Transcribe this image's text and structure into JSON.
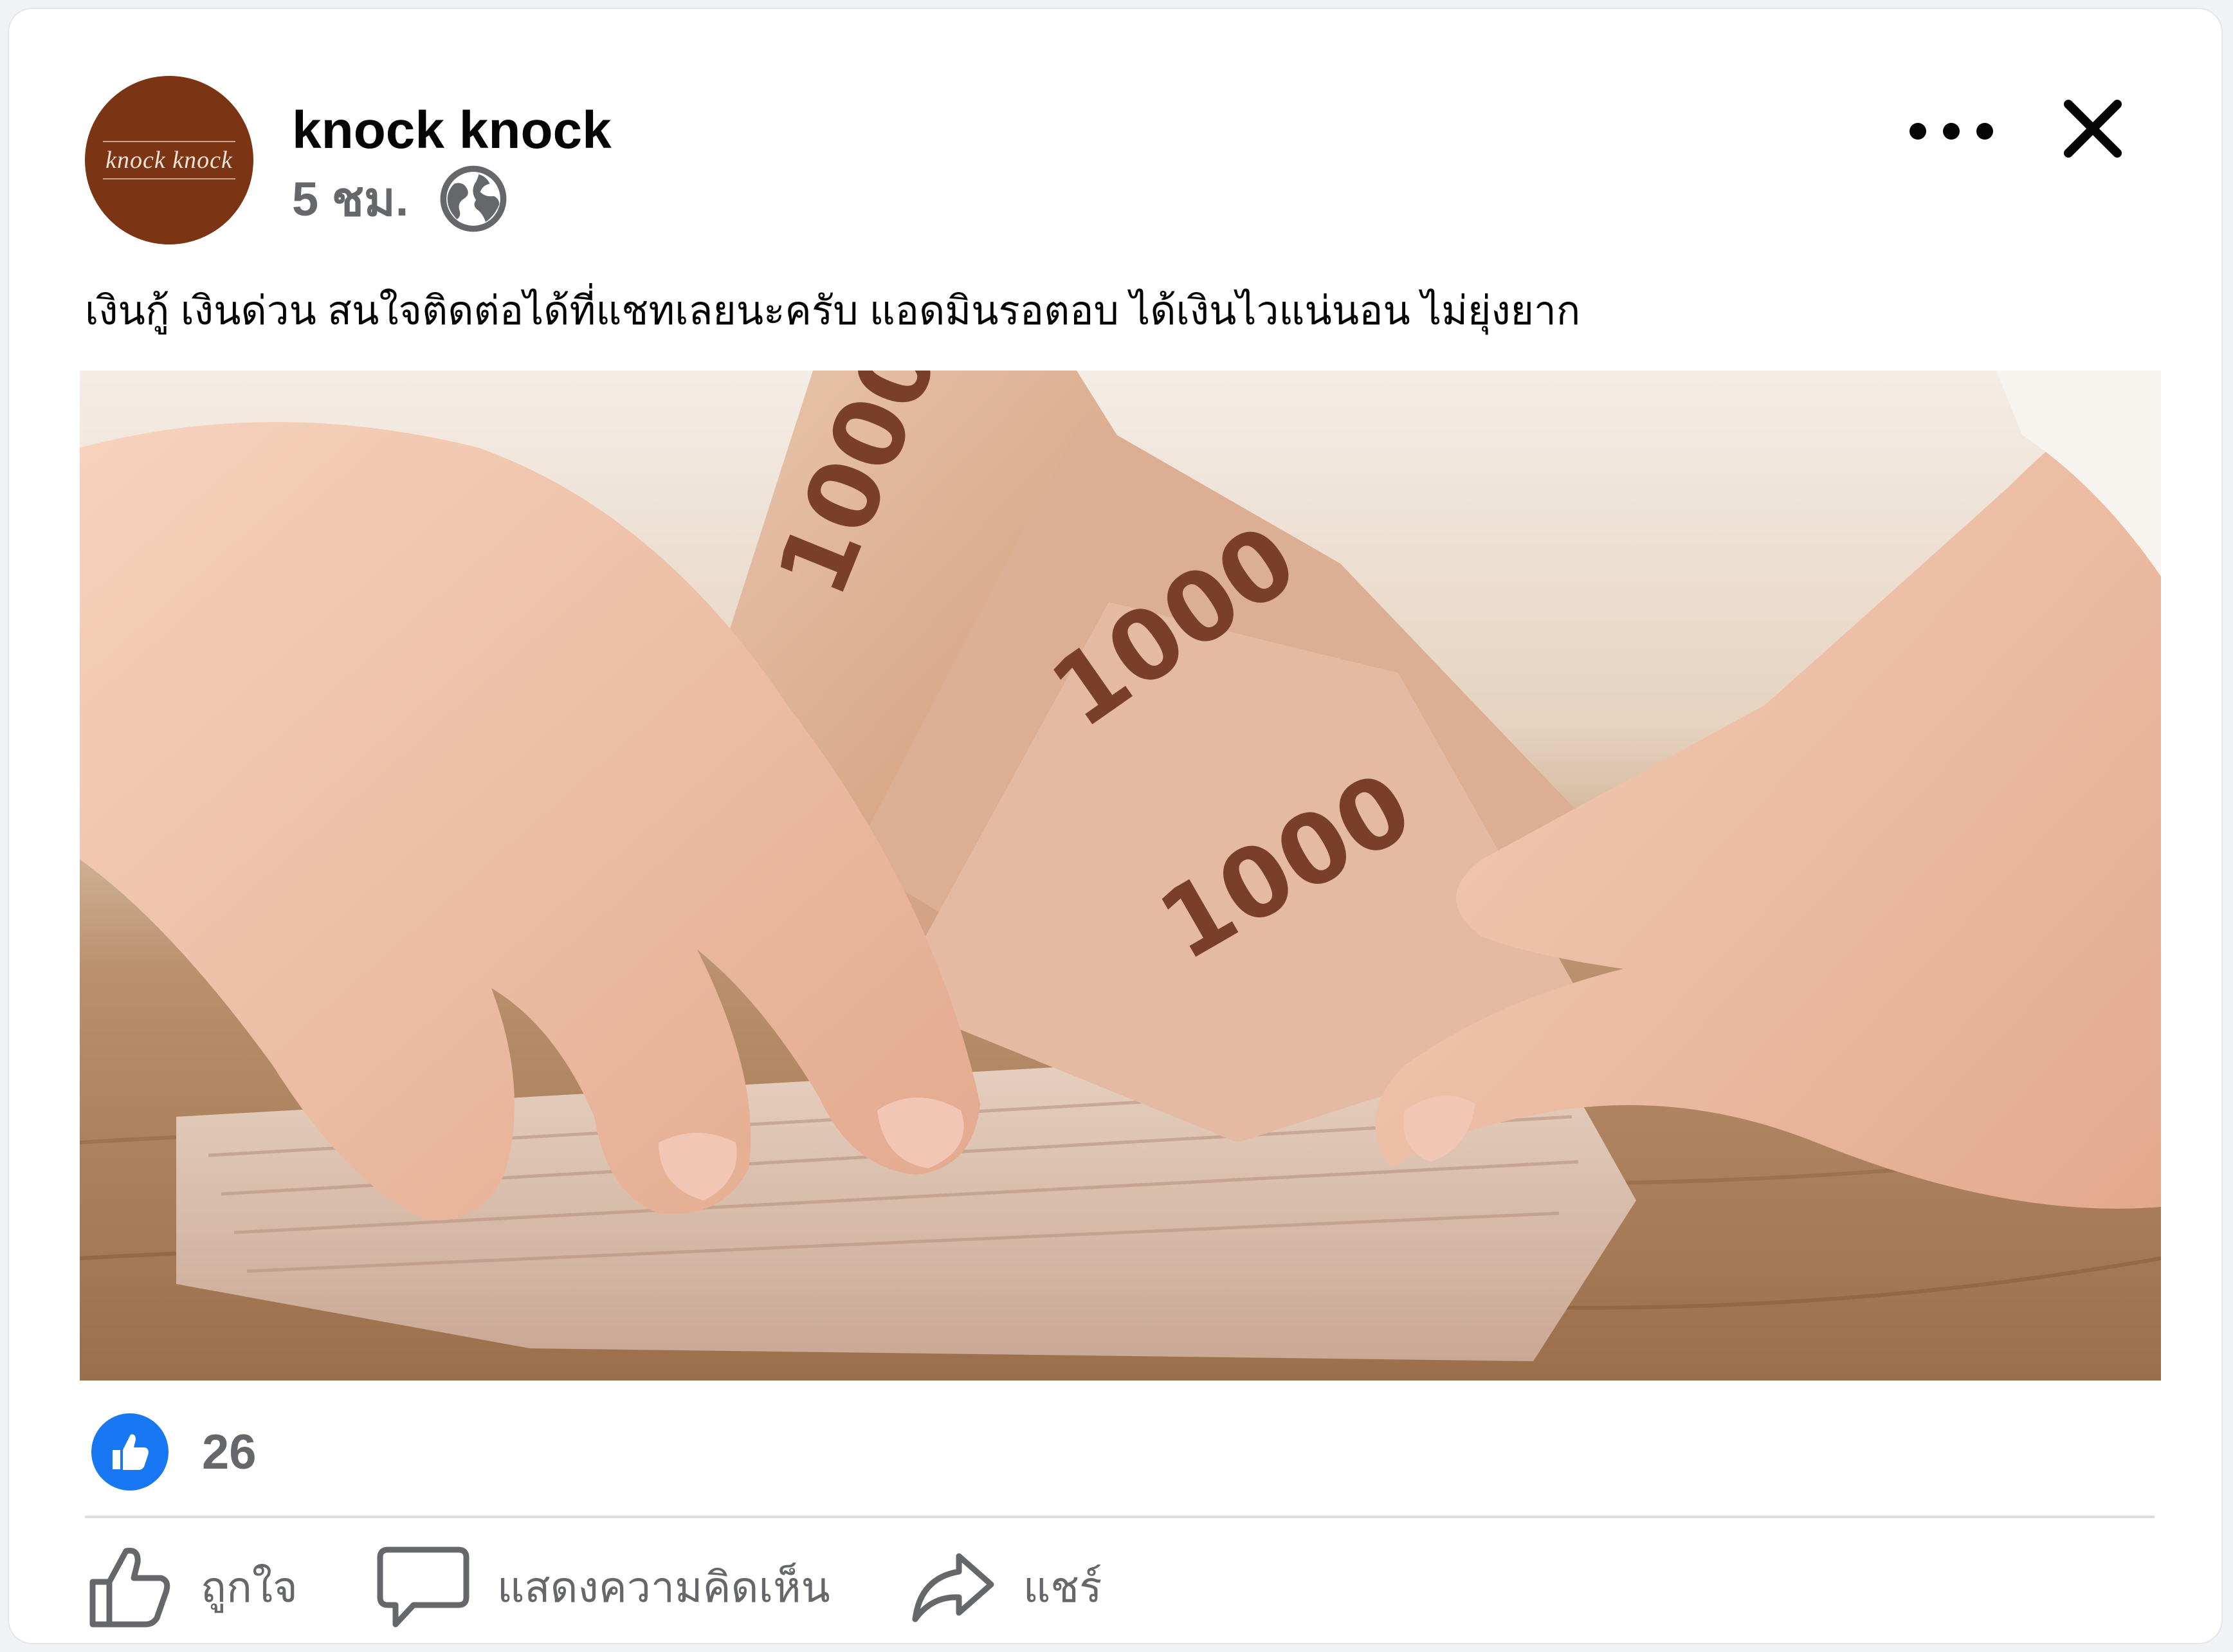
{
  "post": {
    "page_name": "knock knock",
    "avatar_text": "knock knock",
    "timestamp": "5 ชม.",
    "audience_icon": "globe-icon",
    "text": "เงินกู้ เงินด่วน สนใจติดต่อได้ที่แชทเลยนะครับ แอดมินรอตอบ ได้เงินไวแน่นอน ไม่ยุ่งยาก",
    "image_note_text": "1000"
  },
  "header": {
    "more_icon": "more-horizontal-icon",
    "close_icon": "close-icon"
  },
  "reactions": {
    "icon": "like-reaction-icon",
    "count": "26"
  },
  "actions": {
    "like_label": "ถูกใจ",
    "comment_label": "แสดงความคิดเห็น",
    "share_label": "แชร์"
  },
  "colors": {
    "brand_blue": "#1877f2",
    "secondary_text": "#65676b",
    "avatar_bg": "#7b3414"
  }
}
